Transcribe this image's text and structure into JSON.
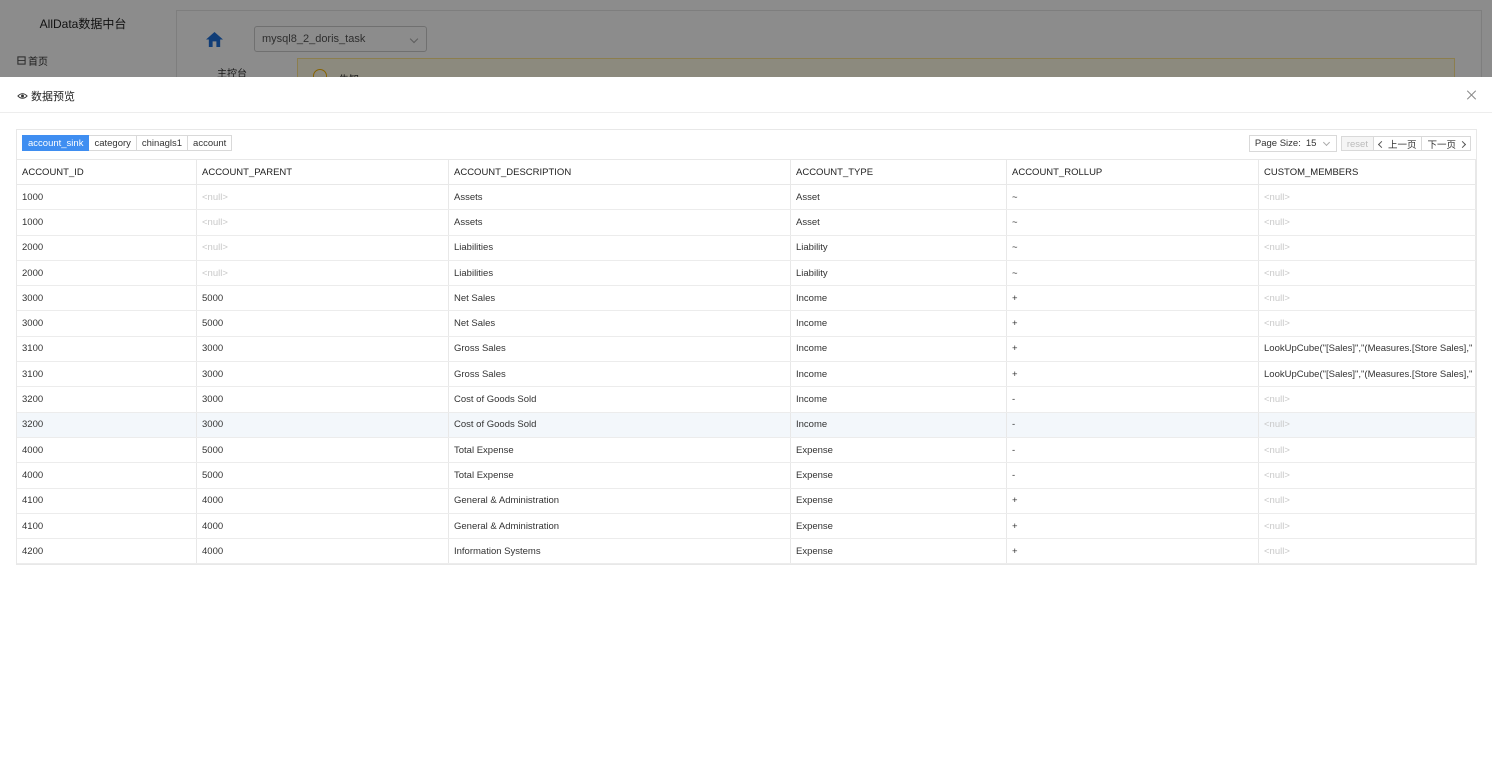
{
  "app": {
    "brand": "AllData数据中台",
    "nav_home": "首页",
    "console_label": "主控台",
    "task_select": "mysql8_2_doris_task",
    "notice_title": "告知"
  },
  "modal": {
    "title": "数据预览",
    "tabs": [
      {
        "label": "account_sink",
        "active": true
      },
      {
        "label": "category",
        "active": false
      },
      {
        "label": "chinagls1",
        "active": false
      },
      {
        "label": "account",
        "active": false
      }
    ],
    "pager": {
      "page_size_label": "Page Size:",
      "page_size_value": "15",
      "reset": "reset",
      "prev": "上一页",
      "next": "下一页"
    },
    "columns": [
      "ACCOUNT_ID",
      "ACCOUNT_PARENT",
      "ACCOUNT_DESCRIPTION",
      "ACCOUNT_TYPE",
      "ACCOUNT_ROLLUP",
      "CUSTOM_MEMBERS"
    ],
    "rows": [
      [
        "1000",
        "<null>",
        "Assets",
        "Asset",
        "~",
        "<null>"
      ],
      [
        "1000",
        "<null>",
        "Assets",
        "Asset",
        "~",
        "<null>"
      ],
      [
        "2000",
        "<null>",
        "Liabilities",
        "Liability",
        "~",
        "<null>"
      ],
      [
        "2000",
        "<null>",
        "Liabilities",
        "Liability",
        "~",
        "<null>"
      ],
      [
        "3000",
        "5000",
        "Net Sales",
        "Income",
        "+",
        "<null>"
      ],
      [
        "3000",
        "5000",
        "Net Sales",
        "Income",
        "+",
        "<null>"
      ],
      [
        "3100",
        "3000",
        "Gross Sales",
        "Income",
        "+",
        "LookUpCube(\"[Sales]\",\"(Measures.[Store Sales],\""
      ],
      [
        "3100",
        "3000",
        "Gross Sales",
        "Income",
        "+",
        "LookUpCube(\"[Sales]\",\"(Measures.[Store Sales],\""
      ],
      [
        "3200",
        "3000",
        "Cost of Goods Sold",
        "Income",
        "-",
        "<null>"
      ],
      [
        "3200",
        "3000",
        "Cost of Goods Sold",
        "Income",
        "-",
        "<null>"
      ],
      [
        "4000",
        "5000",
        "Total Expense",
        "Expense",
        "-",
        "<null>"
      ],
      [
        "4000",
        "5000",
        "Total Expense",
        "Expense",
        "-",
        "<null>"
      ],
      [
        "4100",
        "4000",
        "General & Administration",
        "Expense",
        "+",
        "<null>"
      ],
      [
        "4100",
        "4000",
        "General & Administration",
        "Expense",
        "+",
        "<null>"
      ],
      [
        "4200",
        "4000",
        "Information Systems",
        "Expense",
        "+",
        "<null>"
      ]
    ],
    "highlighted_row": 9
  },
  "colors": {
    "accent": "#3f8ef1",
    "null_text": "#c8c8c8",
    "row_hover": "#f3f7fb"
  }
}
